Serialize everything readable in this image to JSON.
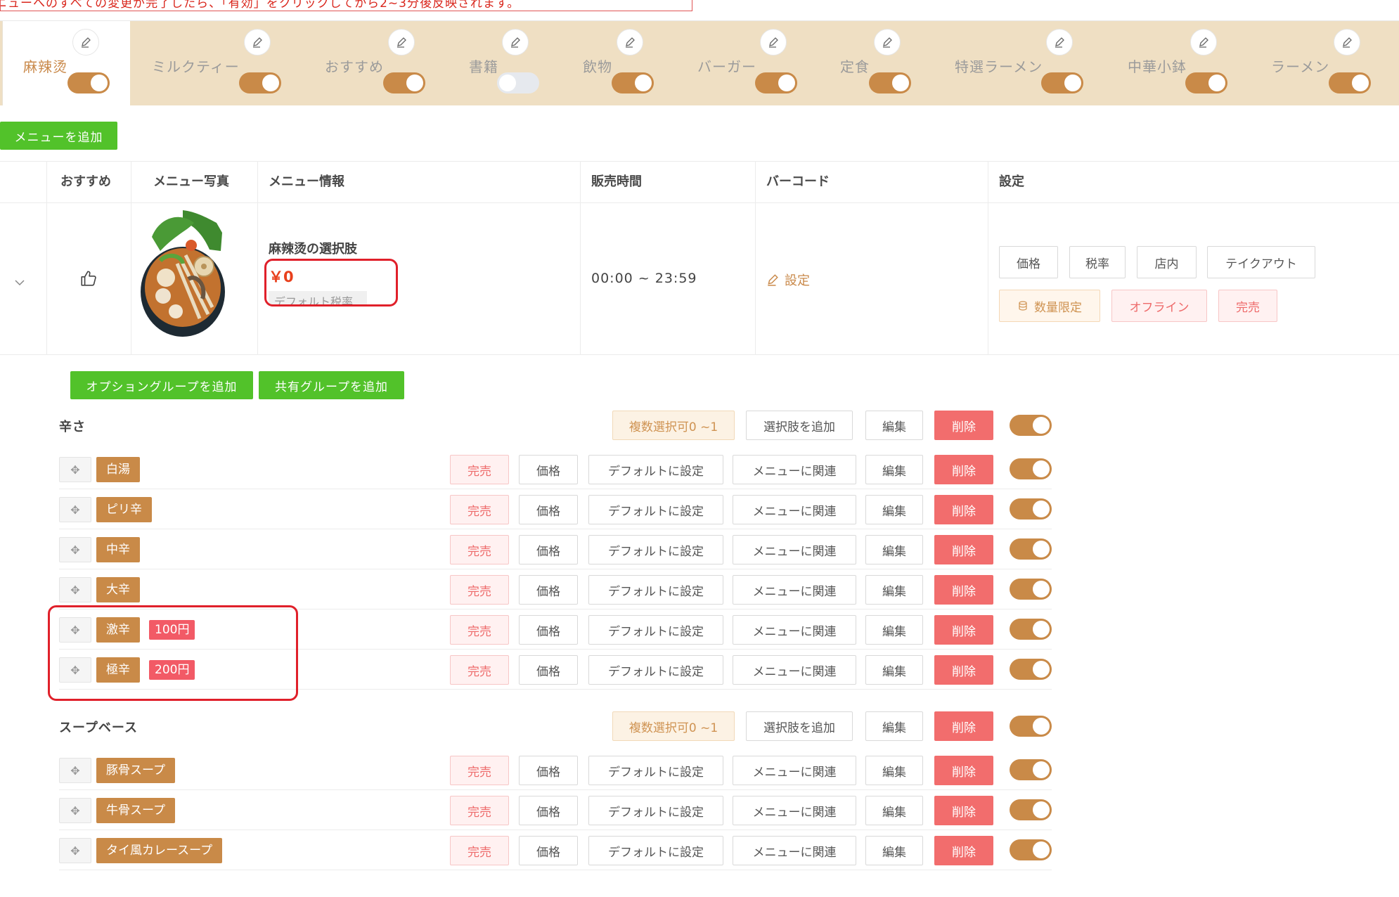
{
  "notice": "ニューへのすべての変更が完了したら、「有効」をクリックしてから2~3分後反映されます。",
  "categories": [
    {
      "label": "麻辣烫",
      "enabled": true,
      "active": true
    },
    {
      "label": "ミルクティー",
      "enabled": true
    },
    {
      "label": "おすすめ",
      "enabled": true
    },
    {
      "label": "書籍",
      "enabled": false
    },
    {
      "label": "飲物",
      "enabled": true
    },
    {
      "label": "バーガー",
      "enabled": true
    },
    {
      "label": "定食",
      "enabled": true
    },
    {
      "label": "特選ラーメン",
      "enabled": true
    },
    {
      "label": "中華小鉢",
      "enabled": true
    },
    {
      "label": "ラーメン",
      "enabled": true
    }
  ],
  "add_menu_label": "メニューを追加",
  "table": {
    "headers": [
      "おすすめ",
      "メニュー写真",
      "メニュー情報",
      "販売時間",
      "バーコード",
      "設定"
    ]
  },
  "menu_item": {
    "title": "麻辣烫の選択肢",
    "price": "￥0",
    "tax": "デフォルト税率",
    "sale_time": "00:00 ~ 23:59",
    "barcode_label": "設定",
    "settings_buttons": [
      "価格",
      "税率",
      "店内",
      "テイクアウト"
    ],
    "status_buttons": [
      "数量限定",
      "オフライン",
      "完売"
    ]
  },
  "add_option_group_label": "オプショングループを追加",
  "add_shared_group_label": "共有グループを追加",
  "group_actions": {
    "multi": "複数選択可0 ~1",
    "add_choice": "選択肢を追加",
    "edit": "編集",
    "delete": "削除"
  },
  "option_actions": {
    "soldout": "完売",
    "price": "価格",
    "default": "デフォルトに設定",
    "relate": "メニューに関連",
    "edit": "編集",
    "delete": "削除"
  },
  "groups": [
    {
      "name": "辛さ",
      "options": [
        {
          "name": "白湯"
        },
        {
          "name": "ピリ辛"
        },
        {
          "name": "中辛"
        },
        {
          "name": "大辛"
        },
        {
          "name": "激辛",
          "price": "100円"
        },
        {
          "name": "極辛",
          "price": "200円"
        }
      ]
    },
    {
      "name": "スープベース",
      "options": [
        {
          "name": "豚骨スープ"
        },
        {
          "name": "牛骨スープ"
        },
        {
          "name": "タイ風カレースープ"
        }
      ]
    }
  ],
  "colors": {
    "accent": "#c98a48",
    "tabbar": "#efdfc3",
    "green": "#52c22a",
    "danger": "#f26d6d",
    "price_red": "#e8401c"
  }
}
